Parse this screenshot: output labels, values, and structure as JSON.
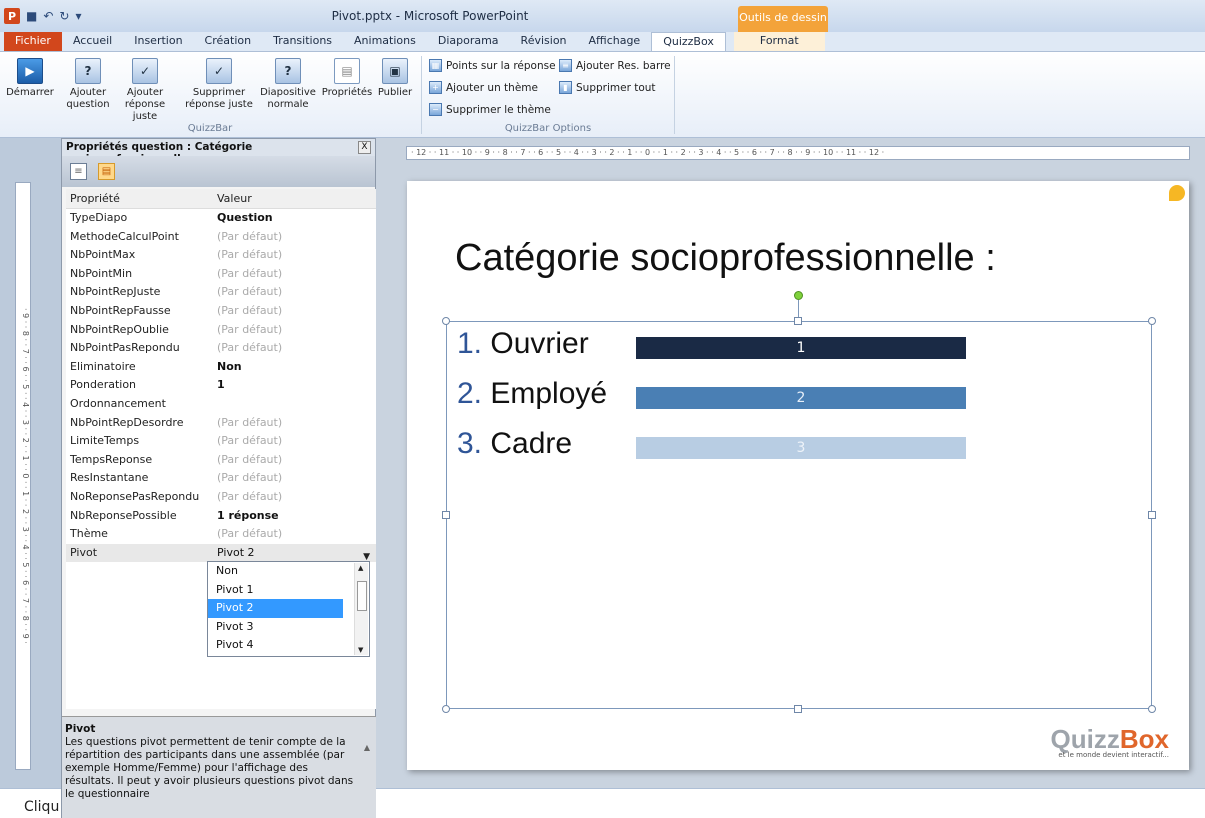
{
  "window": {
    "title": "Pivot.pptx - Microsoft PowerPoint",
    "contextual_title": "Outils de dessin"
  },
  "tabs": [
    "Fichier",
    "Accueil",
    "Insertion",
    "Création",
    "Transitions",
    "Animations",
    "Diaporama",
    "Révision",
    "Affichage",
    "QuizzBox",
    "Format"
  ],
  "ribbon": {
    "buttons": [
      {
        "label": "Démarrer",
        "icon": "play-icon"
      },
      {
        "label": "Ajouter question",
        "icon": "add-question-icon"
      },
      {
        "label": "Ajouter réponse juste",
        "icon": "add-answer-icon"
      },
      {
        "label": "Supprimer réponse juste",
        "icon": "remove-answer-icon"
      },
      {
        "label": "Diapositive normale",
        "icon": "normal-slide-icon"
      },
      {
        "label": "Propriétés",
        "icon": "properties-icon"
      },
      {
        "label": "Publier",
        "icon": "publish-icon"
      }
    ],
    "group1_label": "QuizzBar",
    "options": {
      "points": "Points sur la réponse",
      "add_res_bar": "Ajouter Res. barre",
      "add_theme": "Ajouter un thème",
      "remove_all": "Supprimer tout",
      "remove_theme": "Supprimer le thème"
    },
    "group2_label": "QuizzBar Options"
  },
  "panel": {
    "title": "Propriétés question : Catégorie socioprofessionnelle",
    "close": "X",
    "col_property": "Propriété",
    "col_value": "Valeur",
    "rows": [
      {
        "name": "TypeDiapo",
        "value": "Question",
        "strong": true
      },
      {
        "name": "MethodeCalculPoint",
        "value": "(Par défaut)"
      },
      {
        "name": "NbPointMax",
        "value": "(Par défaut)"
      },
      {
        "name": "NbPointMin",
        "value": "(Par défaut)"
      },
      {
        "name": "NbPointRepJuste",
        "value": "(Par défaut)"
      },
      {
        "name": "NbPointRepFausse",
        "value": "(Par défaut)"
      },
      {
        "name": "NbPointRepOublie",
        "value": "(Par défaut)"
      },
      {
        "name": "NbPointPasRepondu",
        "value": "(Par défaut)"
      },
      {
        "name": "Eliminatoire",
        "value": "Non",
        "strong": true
      },
      {
        "name": "Ponderation",
        "value": "1",
        "strong": true
      },
      {
        "name": "Ordonnancement",
        "value": ""
      },
      {
        "name": "NbPointRepDesordre",
        "value": "(Par défaut)"
      },
      {
        "name": "LimiteTemps",
        "value": "(Par défaut)"
      },
      {
        "name": "TempsReponse",
        "value": "(Par défaut)"
      },
      {
        "name": "ResInstantane",
        "value": "(Par défaut)"
      },
      {
        "name": "NoReponsePasRepondu",
        "value": "(Par défaut)"
      },
      {
        "name": "NbReponsePossible",
        "value": "1 réponse",
        "strong": true
      },
      {
        "name": "Thème",
        "value": "(Par défaut)"
      },
      {
        "name": "Pivot",
        "value": "Pivot 2",
        "selected": true
      }
    ],
    "dropdown_options": [
      "Non",
      "Pivot 1",
      "Pivot 2",
      "Pivot 3",
      "Pivot 4"
    ],
    "dropdown_selected": "Pivot 2",
    "description_title": "Pivot",
    "description_text": "Les questions pivot permettent de tenir compte de la répartition des participants dans une assemblée (par exemple Homme/Femme) pour l'affichage des résultats. Il peut y avoir plusieurs questions pivot dans le questionnaire"
  },
  "slide": {
    "title": "Catégorie socioprofessionnelle :",
    "options": [
      {
        "num": "1.",
        "label": "Ouvrier",
        "bar_label": "1"
      },
      {
        "num": "2.",
        "label": "Employé",
        "bar_label": "2"
      },
      {
        "num": "3.",
        "label": "Cadre",
        "bar_label": "3"
      }
    ],
    "logo": {
      "quizz": "Quizz",
      "box": "Box",
      "tagline": "et le monde devient interactif..."
    }
  },
  "rulers": {
    "horizontal": "· 12 · · 11 · · 10 · · 9 · · 8 · · 7 · · 6 · · 5 · · 4 · · 3 · · 2 · · 1 · · 0 · · 1 · · 2 · · 3 · · 4 · · 5 · · 6 · · 7 · · 8 · · 9 · · 10 · · 11 · · 12 ·",
    "vertical": "· 9 · · 8 · · 7 · · 6 · · 5 · · 4 · · 3 · · 2 · · 1 · · 0 · · 1 · · 2 · · 3 · · 4 · · 5 · · 6 · · 7 · · 8 · · 9 ·"
  },
  "status": {
    "text": "Cliqu"
  }
}
